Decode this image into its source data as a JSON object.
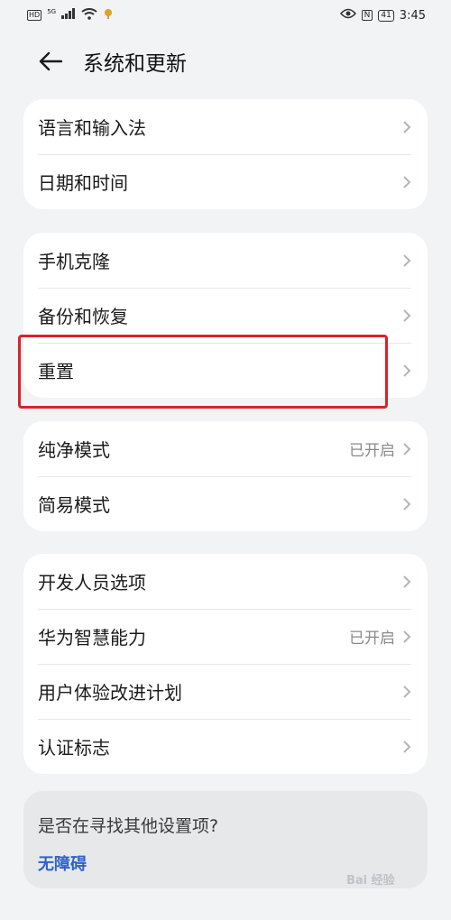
{
  "status_bar": {
    "hd_tag": "HD",
    "network": "5G",
    "time": "3:45",
    "nfc": "N",
    "battery": "41"
  },
  "header": {
    "title": "系统和更新"
  },
  "groups": [
    {
      "items": [
        {
          "label": "语言和输入法",
          "value": ""
        },
        {
          "label": "日期和时间",
          "value": ""
        }
      ]
    },
    {
      "items": [
        {
          "label": "手机克隆",
          "value": ""
        },
        {
          "label": "备份和恢复",
          "value": ""
        },
        {
          "label": "重置",
          "value": ""
        }
      ]
    },
    {
      "items": [
        {
          "label": "纯净模式",
          "value": "已开启"
        },
        {
          "label": "简易模式",
          "value": ""
        }
      ]
    },
    {
      "items": [
        {
          "label": "开发人员选项",
          "value": ""
        },
        {
          "label": "华为智慧能力",
          "value": "已开启"
        },
        {
          "label": "用户体验改进计划",
          "value": ""
        },
        {
          "label": "认证标志",
          "value": ""
        }
      ]
    }
  ],
  "search_card": {
    "question": "是否在寻找其他设置项?",
    "link": "无障碍"
  },
  "watermark": "Bai 经验",
  "colors": {
    "background": "#f1f3f5",
    "card": "#ffffff",
    "highlight": "#d8232a",
    "link": "#2f63c8",
    "secondary_text": "#8a8a8a"
  }
}
